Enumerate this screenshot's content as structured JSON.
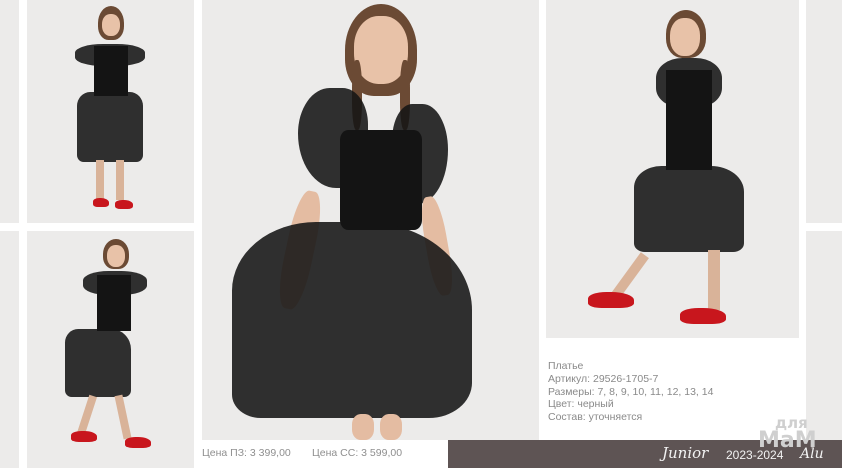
{
  "product": {
    "name": "Платье",
    "article": "Артикул: 29526-1705-7",
    "sizes": "Размеры: 7, 8, 9, 10, 11, 12, 13, 14",
    "color": "Цвет: черный",
    "composition": "Состав: уточняется"
  },
  "prices": {
    "pz": "Цена ПЗ: 3 399,00",
    "ss": "Цена СС: 3 599,00"
  },
  "footer": {
    "brand": "Junior",
    "season": "2023-2024",
    "logo": "Alu",
    "watermark_top": "для",
    "watermark_bottom": "МаМ"
  },
  "colors": {
    "dress": "#141414",
    "shoes": "#c8161d",
    "background": "#ecebea",
    "footer_band": "#5e5454"
  }
}
